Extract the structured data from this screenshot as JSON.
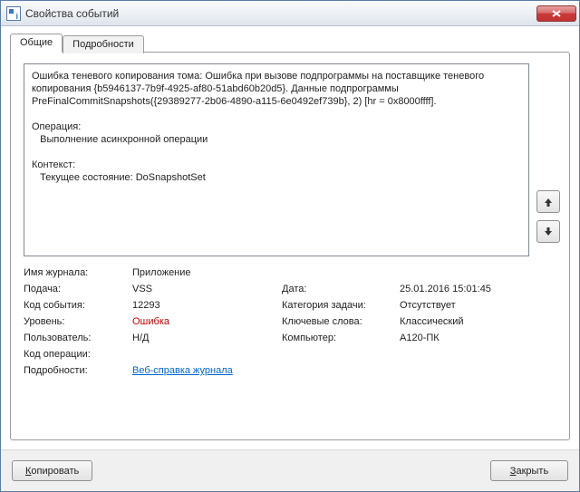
{
  "window": {
    "title": "Свойства событий",
    "close": "×"
  },
  "tabs": {
    "general": "Общие",
    "details": "Подробности"
  },
  "message": {
    "body": "Ошибка теневого копирования тома: Ошибка при вызове подпрограммы на поставщике теневого копирования {b5946137-7b9f-4925-af80-51abd60b20d5}. Данные подпрограммы PreFinalCommitSnapshots({29389277-2b06-4890-a115-6e0492ef739b}, 2) [hr = 0x8000ffff].",
    "operation_label": "Операция:",
    "operation_value": "   Выполнение асинхронной операции",
    "context_label": "Контекст:",
    "context_value": "   Текущее состояние: DoSnapshotSet"
  },
  "props": {
    "log_name_label": "Имя журнала:",
    "log_name_value": "Приложение",
    "source_label": "Подача:",
    "source_value": "VSS",
    "date_label": "Дата:",
    "date_value": "25.01.2016 15:01:45",
    "event_id_label": "Код события:",
    "event_id_value": "12293",
    "category_label": "Категория задачи:",
    "category_value": "Отсутствует",
    "level_label": "Уровень:",
    "level_value": "Ошибка",
    "keywords_label": "Ключевые слова:",
    "keywords_value": "Классический",
    "user_label": "Пользователь:",
    "user_value": "Н/Д",
    "computer_label": "Компьютер:",
    "computer_value": "A120-ПК",
    "opcode_label": "Код операции:",
    "opcode_value": "",
    "details_label": "Подробности:",
    "details_link": "Веб-справка журнала"
  },
  "buttons": {
    "copy": "Копировать",
    "close": "Закрыть"
  }
}
